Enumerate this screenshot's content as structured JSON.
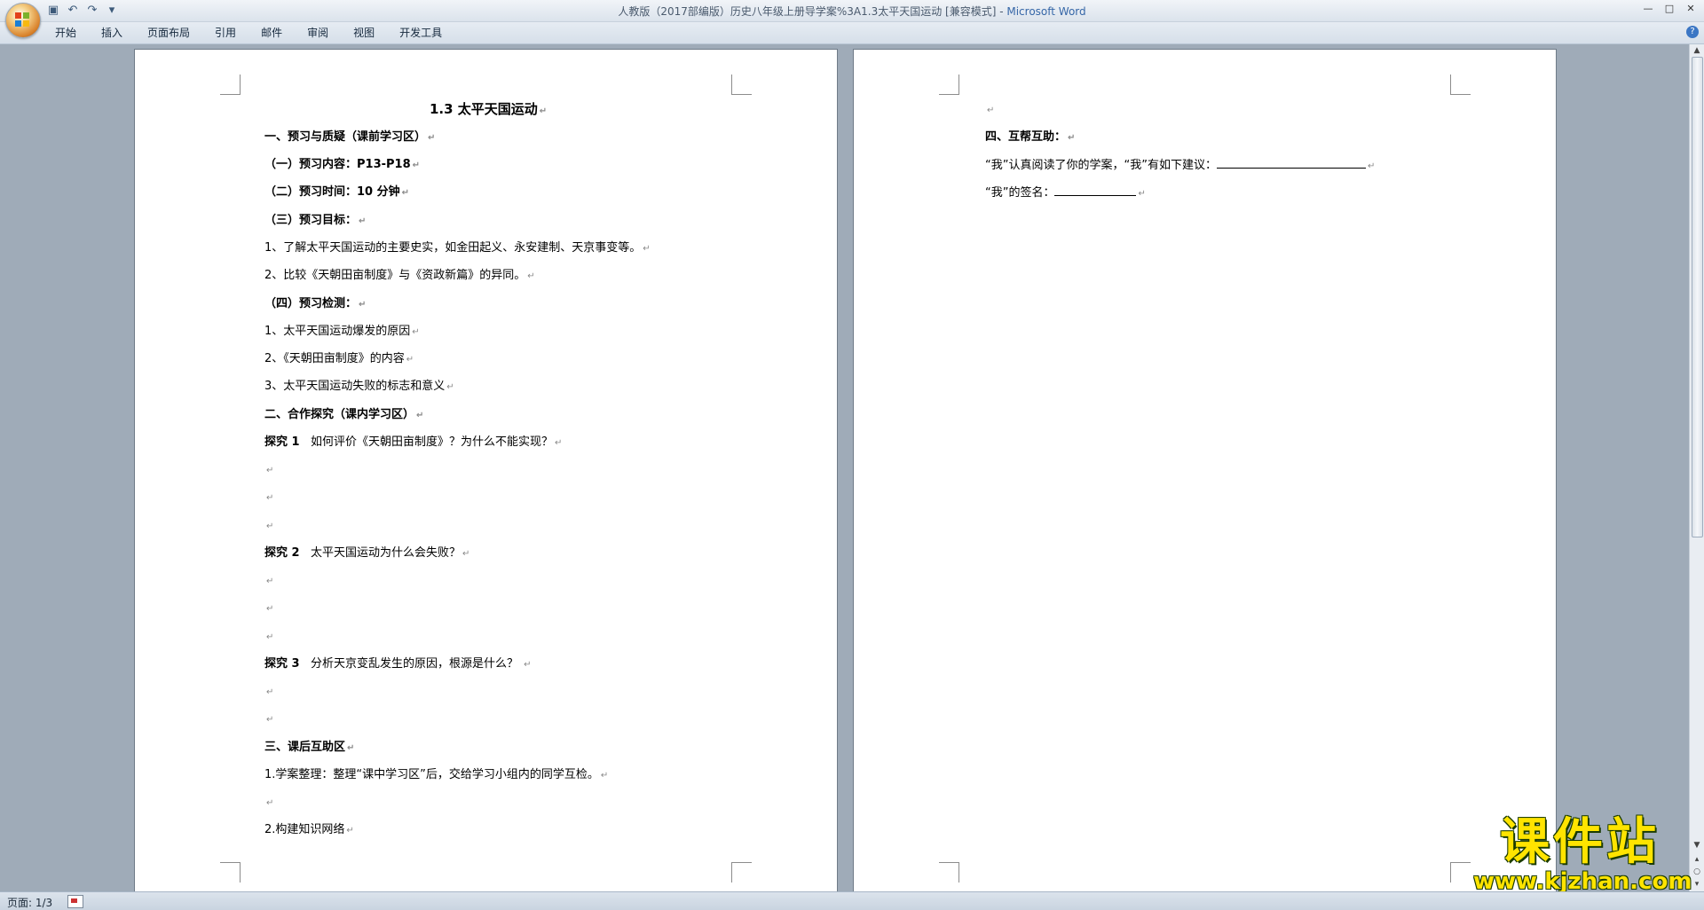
{
  "window": {
    "title": "人教版（2017部编版）历史八年级上册导学案%3A1.3太平天国运动 [兼容模式] - ",
    "app_name": "Microsoft Word",
    "controls": [
      "—",
      "□",
      "✕"
    ]
  },
  "quick_access": {
    "save": "save-icon",
    "undo": "undo-icon",
    "redo": "redo-icon",
    "customize": "▾"
  },
  "menu": {
    "items": [
      "开始",
      "插入",
      "页面布局",
      "引用",
      "邮件",
      "审阅",
      "视图",
      "开发工具"
    ]
  },
  "help_icon": "?",
  "page1": {
    "title": "1.3 太平天国运动",
    "lines": [
      "一、预习与质疑（课前学习区）",
      "（一）预习内容：P13-P18",
      "（二）预习时间：10 分钟",
      "（三）预习目标：",
      "1、了解太平天国运动的主要史实，如金田起义、永安建制、天京事变等。",
      "2、比较《天朝田亩制度》与《资政新篇》的异同。",
      "（四）预习检测：",
      "1、太平天国运动爆发的原因",
      "2、《天朝田亩制度》的内容",
      "3、太平天国运动失败的标志和意义",
      "二、合作探究（课内学习区）",
      "探究 1",
      "如何评价《天朝田亩制度》？为什么不能实现？",
      "探究 2",
      "太平天国运动为什么会失败？",
      "探究 3",
      "分析天京变乱发生的原因，根源是什么？",
      "三、课后互助区",
      "1.学案整理：整理“课中学习区”后，交给学习小组内的同学互检。",
      "2.构建知识网络"
    ],
    "paragraph_mark": "↵"
  },
  "page2": {
    "heading": "四、互帮互助：",
    "suggestion": "“我”认真阅读了你的学案，“我”有如下建议：",
    "signature": "“我”的签名："
  },
  "status": {
    "page_indicator": "页面: 1/3"
  },
  "watermark": {
    "line1": "课件站",
    "line2": "www.kjzhan.com"
  }
}
